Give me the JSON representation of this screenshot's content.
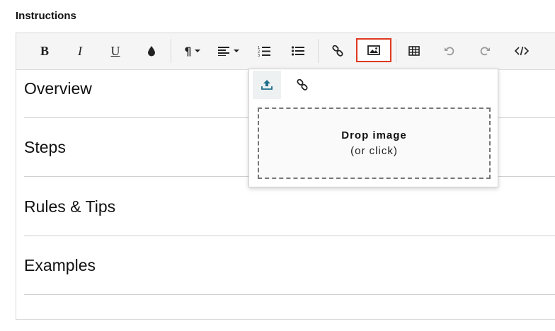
{
  "field_label": "Instructions",
  "toolbar": {
    "bold": "B",
    "italic": "I",
    "underline": "U",
    "paragraph": "¶",
    "active_button": "insert-image-button"
  },
  "sections": [
    "Overview",
    "Steps",
    "Rules & Tips",
    "Examples"
  ],
  "image_popover": {
    "tabs": [
      "upload-icon",
      "link-icon"
    ],
    "selected_tab": "upload",
    "drop_title": "Drop image",
    "drop_subtitle": "(or click)"
  },
  "colors": {
    "active_border": "#e0391f",
    "upload_icon": "#1d6f8a"
  }
}
